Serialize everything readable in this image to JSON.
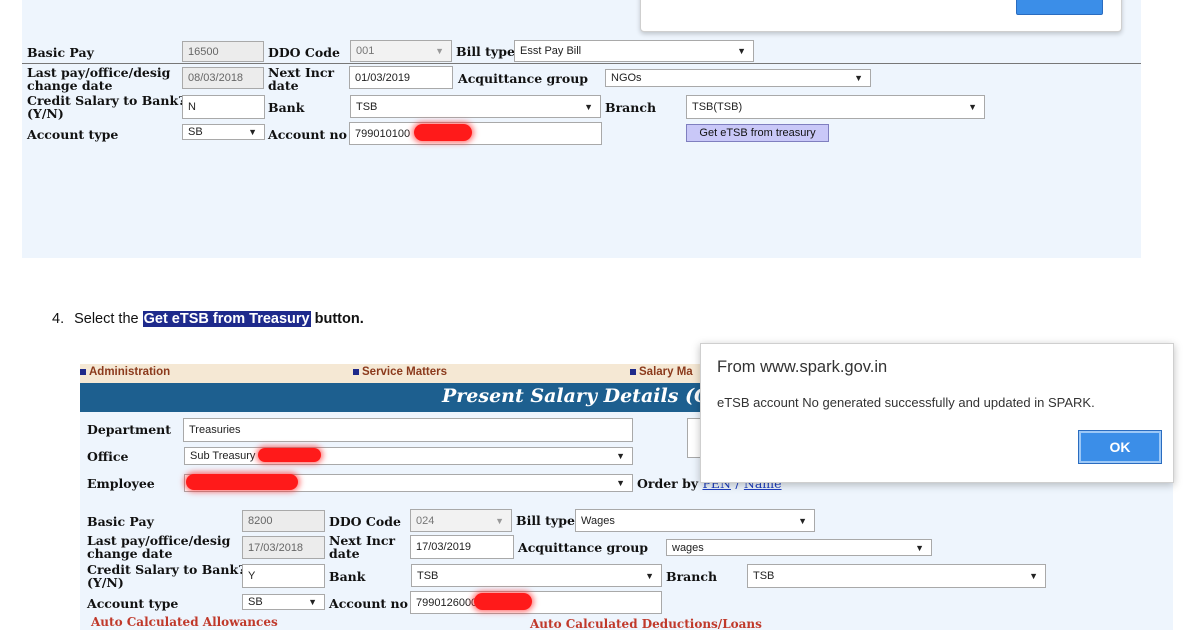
{
  "top_form": {
    "basic_pay": {
      "label": "Basic Pay",
      "value": "16500"
    },
    "ddo_code": {
      "label": "DDO Code",
      "value": "001"
    },
    "bill_type": {
      "label": "Bill type",
      "value": "Esst Pay Bill"
    },
    "last_pay_change": {
      "label_line1": "Last pay/office/desig",
      "label_line2": "change date",
      "value": "08/03/2018"
    },
    "next_incr": {
      "label_line1": "Next Incr",
      "label_line2": "date",
      "value": "01/03/2019"
    },
    "acquittance_group": {
      "label": "Acquittance group",
      "value": "NGOs"
    },
    "credit_salary": {
      "label_line1": "Credit Salary to Bank?",
      "label_line2": "(Y/N)",
      "value": "N"
    },
    "bank": {
      "label": "Bank",
      "value": "TSB"
    },
    "branch": {
      "label": "Branch",
      "value": "TSB(TSB)"
    },
    "account_type": {
      "label": "Account type",
      "value": "SB"
    },
    "account_no": {
      "label": "Account no",
      "value": "799010100"
    },
    "get_etsb_button": "Get eTSB from treasury"
  },
  "instruction": {
    "number": "4.",
    "prefix": "Select the ",
    "highlight": "Get eTSB from Treasury",
    "suffix": " button."
  },
  "bottom_screen": {
    "nav": {
      "administration": "Administration",
      "service_matters": "Service Matters",
      "salary_matters": "Salary Ma"
    },
    "banner_title": "Present Salary Details (Cu",
    "department": {
      "label": "Department",
      "value": "Treasuries"
    },
    "office": {
      "label": "Office",
      "value": "Sub Treasury"
    },
    "employee": {
      "label": "Employee",
      "value": ""
    },
    "order_by": {
      "label": "Order by",
      "pen": "PEN",
      "separator": "/",
      "name": "Name"
    },
    "basic_pay": {
      "label": "Basic Pay",
      "value": "8200"
    },
    "ddo_code": {
      "label": "DDO Code",
      "value": "024"
    },
    "bill_type": {
      "label": "Bill type",
      "value": "Wages"
    },
    "last_pay_change": {
      "label_line1": "Last pay/office/desig",
      "label_line2": "change date",
      "value": "17/03/2018"
    },
    "next_incr": {
      "label_line1": "Next Incr",
      "label_line2": "date",
      "value": "17/03/2019"
    },
    "acquittance_group": {
      "label": "Acquittance group",
      "value": "wages"
    },
    "credit_salary": {
      "label_line1": "Credit Salary to Bank?",
      "label_line2": "(Y/N)",
      "value": "Y"
    },
    "bank": {
      "label": "Bank",
      "value": "TSB"
    },
    "branch": {
      "label": "Branch",
      "value": "TSB"
    },
    "account_type": {
      "label": "Account type",
      "value": "SB"
    },
    "account_no": {
      "label": "Account no",
      "value": "7990126000"
    },
    "auto_allowances": "Auto Calculated Allowances",
    "auto_deductions": "Auto Calculated Deductions/Loans"
  },
  "dialog": {
    "title": "From www.spark.gov.in",
    "message": "eTSB account No generated successfully and updated in SPARK.",
    "ok_label": "OK"
  },
  "icons": {
    "select_arrow": "▼",
    "nav_bullet": "square-bullet-icon"
  },
  "colors": {
    "panel_bg": "#eef5fd",
    "banner_bg": "#1d5f8f",
    "nav_bg": "#f5e8d4",
    "nav_text": "#8b3a1c",
    "redaction": "#ff1a1a",
    "ok_button": "#3b8ee8",
    "highlight_bg": "#1e2a8c"
  }
}
